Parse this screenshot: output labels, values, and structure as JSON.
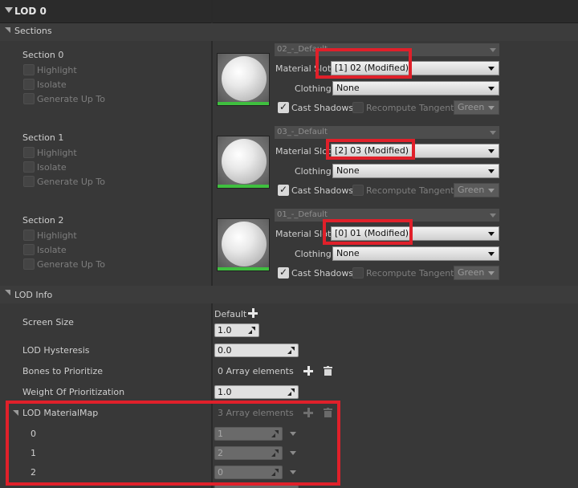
{
  "header": {
    "title": "LOD 0"
  },
  "sections_category": {
    "label": "Sections"
  },
  "sections": [
    {
      "title": "Section 0",
      "highlight_label": "Highlight",
      "isolate_label": "Isolate",
      "generate_label": "Generate Up To",
      "slot_name": "02_-_Default",
      "material_slot_label": "Material Slot",
      "material_slot_value": "[1] 02 (Modified)",
      "clothing_label": "Clothing",
      "clothing_value": "None",
      "cast_shadows_label": "Cast Shadows",
      "recompute_tangent_label": "Recompute Tangent",
      "color_value": "Green"
    },
    {
      "title": "Section 1",
      "highlight_label": "Highlight",
      "isolate_label": "Isolate",
      "generate_label": "Generate Up To",
      "slot_name": "03_-_Default",
      "material_slot_label": "Material Slot",
      "material_slot_value": "[2] 03 (Modified)",
      "clothing_label": "Clothing",
      "clothing_value": "None",
      "cast_shadows_label": "Cast Shadows",
      "recompute_tangent_label": "Recompute Tangent",
      "color_value": "Green"
    },
    {
      "title": "Section 2",
      "highlight_label": "Highlight",
      "isolate_label": "Isolate",
      "generate_label": "Generate Up To",
      "slot_name": "01_-_Default",
      "material_slot_label": "Material Slot",
      "material_slot_value": "[0] 01 (Modified)",
      "clothing_label": "Clothing",
      "clothing_value": "None",
      "cast_shadows_label": "Cast Shadows",
      "recompute_tangent_label": "Recompute Tangent",
      "color_value": "Green"
    }
  ],
  "lod_info": {
    "label": "LOD Info",
    "default_label": "Default",
    "screen_size_label": "Screen Size",
    "screen_size_value": "1.0",
    "hysteresis_label": "LOD Hysteresis",
    "hysteresis_value": "0.0",
    "bones_label": "Bones to Prioritize",
    "bones_value": "0 Array elements",
    "weight_label": "Weight Of Prioritization",
    "weight_value": "1.0",
    "materialmap_label": "LOD MaterialMap",
    "materialmap_value": "3 Array elements",
    "materialmap_items": [
      {
        "index": "0",
        "value": "1"
      },
      {
        "index": "1",
        "value": "2"
      },
      {
        "index": "2",
        "value": "0"
      }
    ]
  },
  "colors": {
    "highlight": "#e0202a",
    "lod_bar": "#3fbf3f"
  }
}
